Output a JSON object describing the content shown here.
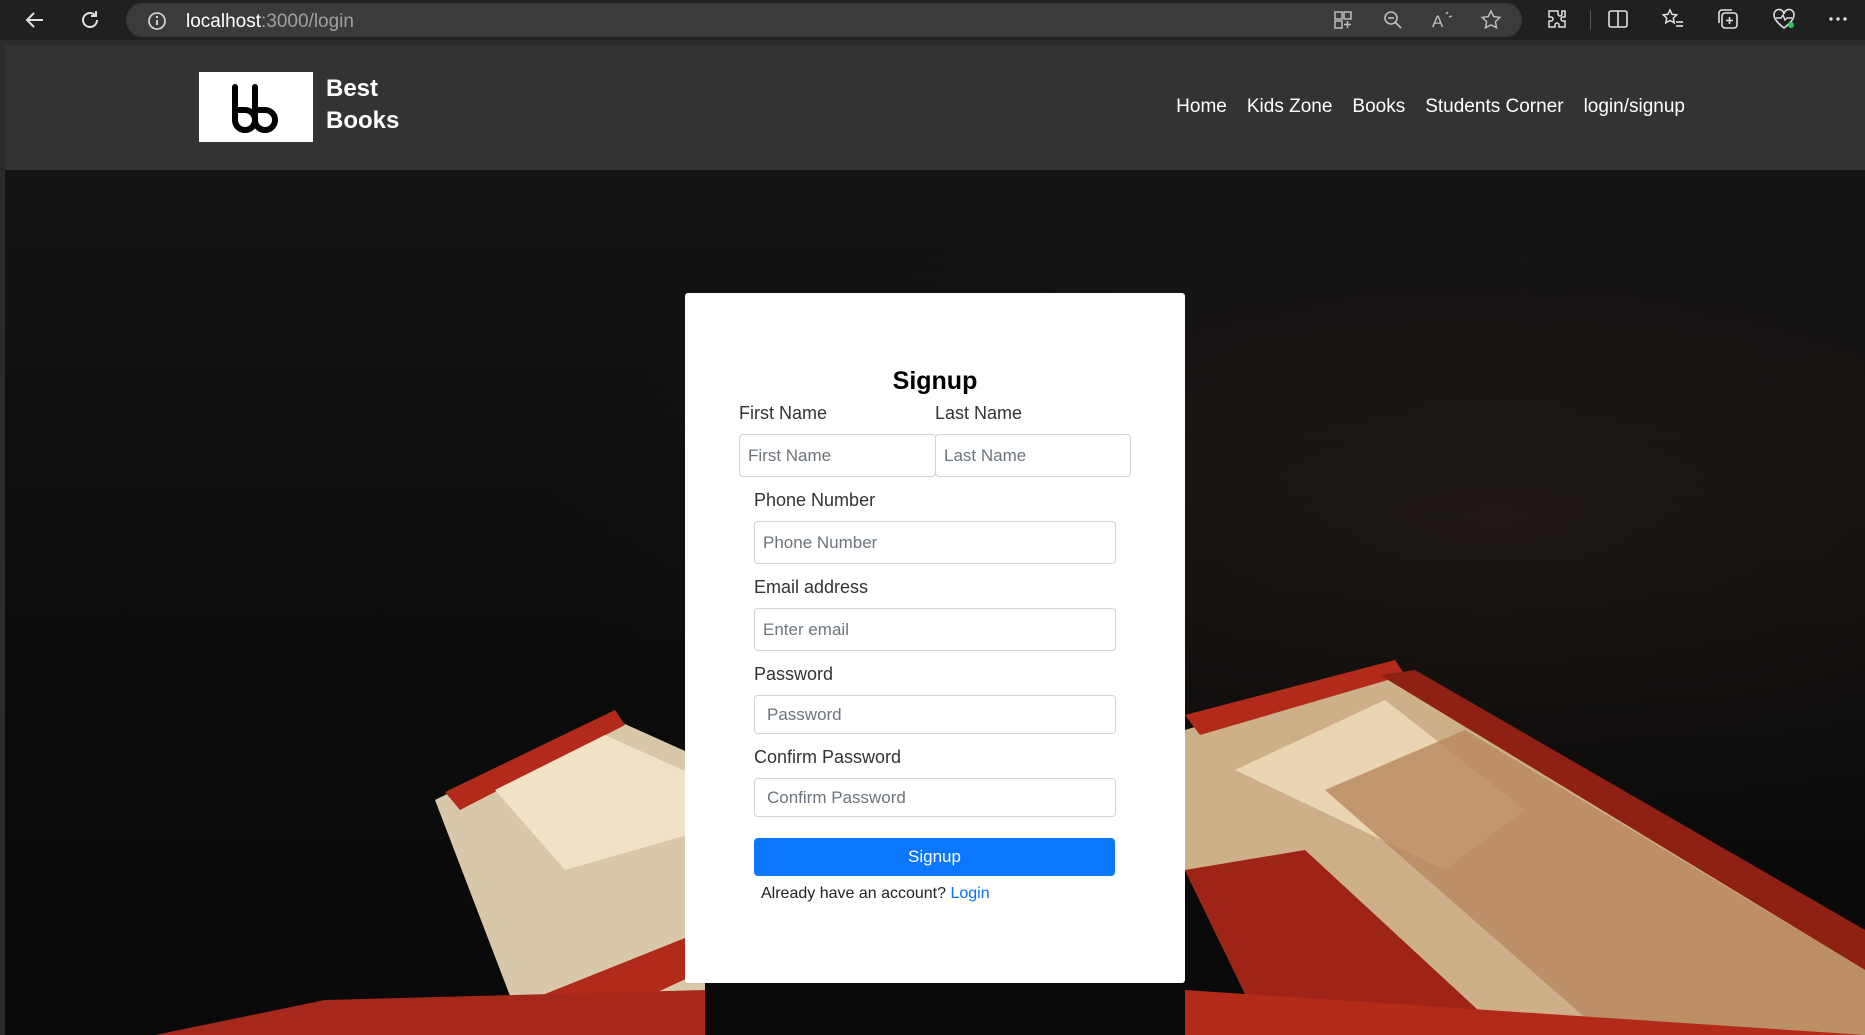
{
  "browser": {
    "url_host": "localhost",
    "url_path": ":3000/login",
    "icons": [
      "back-icon",
      "refresh-icon",
      "site-info-icon",
      "app-grid-icon",
      "zoom-out-icon",
      "read-aloud-icon",
      "favorite-star-icon",
      "extensions-icon",
      "split-screen-icon",
      "favorites-icon",
      "collections-icon",
      "browser-health-icon",
      "more-menu-icon"
    ]
  },
  "header": {
    "logo_text": "bb",
    "brand_line1": "Best",
    "brand_line2": "Books",
    "nav": [
      "Home",
      "Kids Zone",
      "Books",
      "Students Corner",
      "login/signup"
    ]
  },
  "form": {
    "title": "Signup",
    "first_name_label": "First Name",
    "first_name_placeholder": "First Name",
    "last_name_label": "Last Name",
    "last_name_placeholder": "Last Name",
    "phone_label": "Phone Number",
    "phone_placeholder": "Phone Number",
    "email_label": "Email address",
    "email_placeholder": "Enter email",
    "password_label": "Password",
    "password_placeholder": "Password",
    "confirm_label": "Confirm Password",
    "confirm_placeholder": "Confirm Password",
    "submit_label": "Signup",
    "account_prompt": "Already have an account?",
    "login_link": "Login"
  },
  "colors": {
    "header_bg": "#333333",
    "primary_button": "#0b77ff",
    "link": "#0b6efd",
    "book_red": "#b22a1a"
  }
}
